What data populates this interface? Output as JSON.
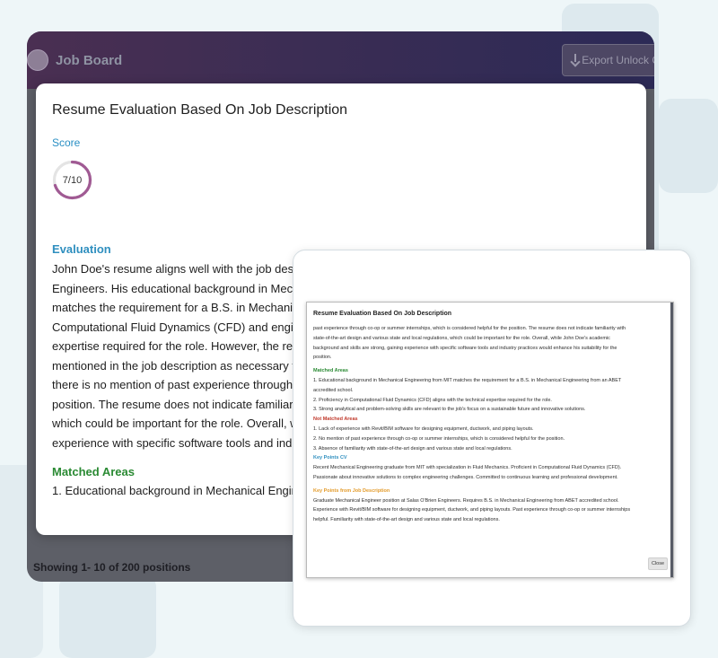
{
  "app": {
    "title": "Job Board",
    "export_label": "Export Unlock C",
    "showing": "Showing 1- 10 of 200 positions"
  },
  "modal": {
    "title": "Resume Evaluation Based On Job Description",
    "score_label": "Score",
    "score_value": "7/10",
    "score_fraction": 0.7,
    "evaluation_heading": "Evaluation",
    "evaluation_lines": [
      "John Doe's resume aligns well with the job descri",
      "Engineers. His educational background in Mechan",
      "matches the requirement for a B.S. in Mechanical",
      "Computational Fluid Dynamics (CFD) and enginee",
      "expertise required for the role. However, the resu",
      "mentioned in the job description as necessary for",
      "there is no mention of past experience through co",
      "position. The resume does not indicate familiarity",
      "which could be important for the role. Overall, wh",
      "experience with specific software tools and indus"
    ],
    "matched_heading": "Matched Areas",
    "matched_first": "1. Educational background in Mechanical Enginee"
  },
  "preview": {
    "title": "Resume Evaluation Based On Job Description",
    "eval_lines": [
      "past experience through co-op or summer internships, which is considered helpful for the position. The resume does not indicate familiarity with",
      "state-of-the-art design and various state and local regulations, which could be important for the role. Overall, while John Doe's academic",
      "background and skills are strong, gaining experience with specific software tools and industry practices would enhance his suitability for the",
      "position."
    ],
    "matched_heading": "Matched Areas",
    "matched_items": [
      "1. Educational background in Mechanical Engineering from MIT matches the requirement for a B.S. in Mechanical Engineering from an ABET",
      "accredited school.",
      "2. Proficiency in Computational Fluid Dynamics (CFD) aligns with the technical expertise required for the role.",
      "3. Strong analytical and problem-solving skills are relevant to the job's focus on a sustainable future and innovative solutions."
    ],
    "not_matched_heading": "Not Matched Areas",
    "not_matched_items": [
      "1. Lack of experience with Revit/BIM software for designing equipment, ductwork, and piping layouts.",
      "2. No mention of past experience through co-op or summer internships, which is considered helpful for the position.",
      "3. Absence of familiarity with state-of-the-art design and various state and local regulations."
    ],
    "cv_heading": "Key Points CV",
    "cv_lines": [
      "Recent Mechanical Engineering graduate from MIT with specialization in Fluid Mechanics. Proficient in Computational Fluid Dynamics (CFD).",
      "Passionate about innovative solutions to complex engineering challenges. Committed to continuous learning and professional development."
    ],
    "job_heading": "Key Points from Job Description",
    "job_lines": [
      "Graduate Mechanical Engineer position at Salas O'Brien Engineers. Requires B.S. in Mechanical Engineering from ABET accredited school.",
      "Experience with Revit/BIM software for designing equipment, ductwork, and piping layouts. Past experience through co-op or summer internships",
      "helpful. Familiarity with state-of-the-art design and various state and local regulations."
    ],
    "close_label": "Close"
  },
  "colors": {
    "score_ring": "#a05a93",
    "score_track": "#e4e4e4",
    "accent_blue": "#2f8fbf",
    "matched_green": "#2a8a33",
    "not_matched_red": "#c0392b",
    "job_orange": "#e39b2b",
    "header_gradient_start": "#4a2f52",
    "header_gradient_end": "#2c2a56"
  }
}
